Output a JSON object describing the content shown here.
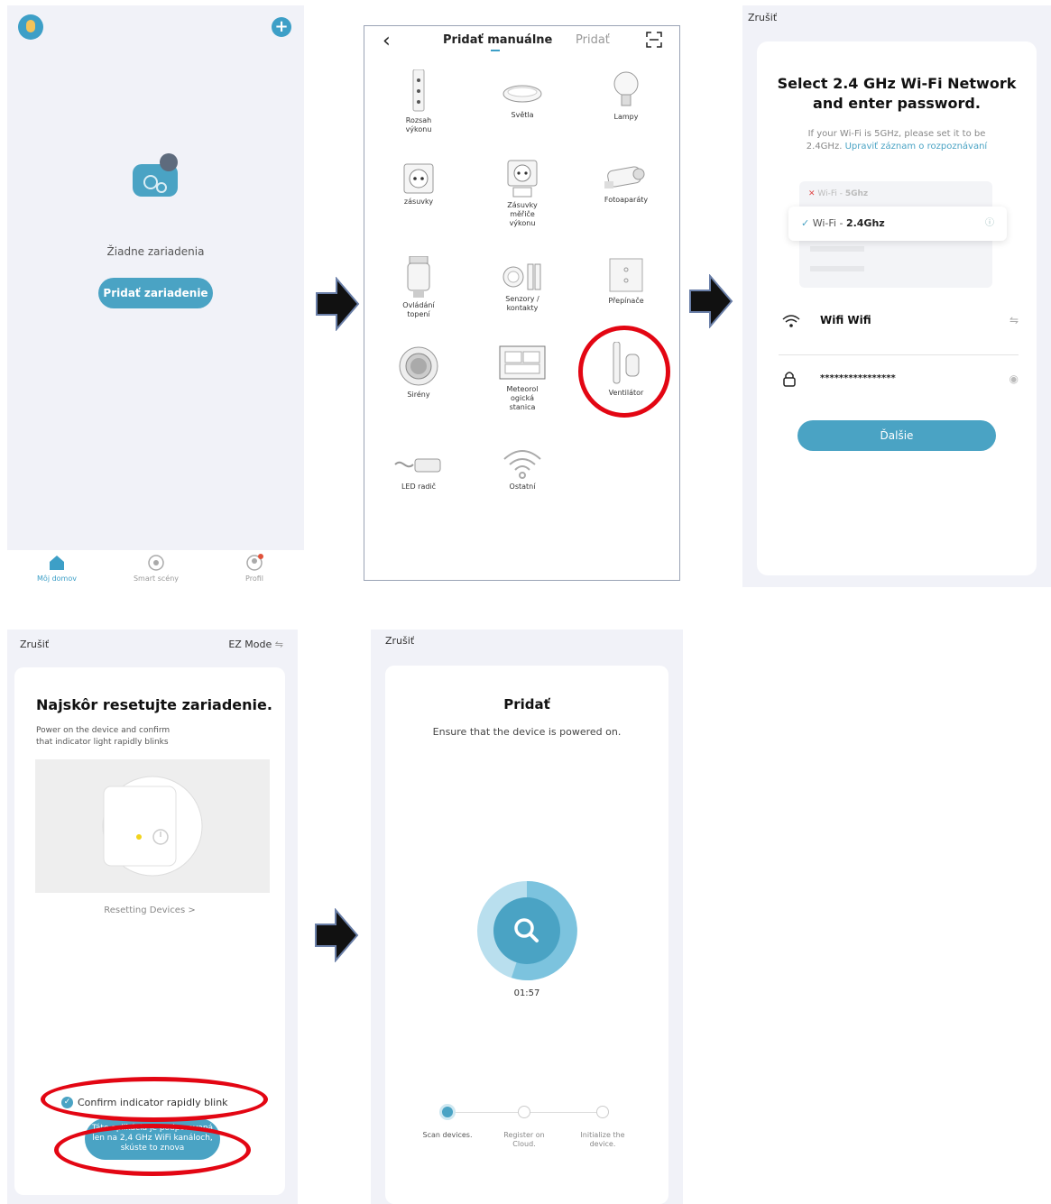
{
  "panel_home": {
    "empty_text": "Žiadne zariadenia",
    "add_button": "Pridať zariadenie",
    "tabs": [
      {
        "label": "Môj domov",
        "active": true
      },
      {
        "label": "Smart scény",
        "active": false
      },
      {
        "label": "Profil",
        "active": false
      }
    ]
  },
  "panel_manual": {
    "tab_active": "Pridať manuálne",
    "tab_other": "Pridať",
    "categories": [
      {
        "label": "Rozsah\nvýkonu"
      },
      {
        "label": "Světla"
      },
      {
        "label": "Lampy"
      },
      {
        "label": "zásuvky"
      },
      {
        "label": "Zásuvky\nměřiče\nvýkonu"
      },
      {
        "label": "Fotoaparáty"
      },
      {
        "label": "Ovládání\ntopení"
      },
      {
        "label": "Senzory /\nkontakty"
      },
      {
        "label": "Přepínače"
      },
      {
        "label": "Sirény"
      },
      {
        "label": "Meteorol\nogická\nstanica"
      },
      {
        "label": "Ventilátor"
      },
      {
        "label": "LED radič"
      },
      {
        "label": "Ostatní"
      }
    ]
  },
  "panel_wifi": {
    "cancel": "Zrušiť",
    "title_line1": "Select 2.4 GHz Wi-Fi Network",
    "title_line2": "and enter password.",
    "hint_line1": "If your Wi-Fi is 5GHz, please set it to be",
    "hint_prefix": "2.4GHz.",
    "hint_link": "Upraviť záznam o rozpoznávaní",
    "net_5g_prefix": "Wi-Fi - ",
    "net_5g_band": "5Ghz",
    "net_24_prefix": "Wi-Fi - ",
    "net_24_band": "2.4Ghz",
    "ssid": "Wifi Wifi",
    "password": "****************",
    "next_button": "Ďalšie"
  },
  "panel_reset": {
    "cancel": "Zrušiť",
    "mode": "EZ Mode",
    "title": "Najskôr resetujte zariadenie.",
    "desc_line1": "Power on the device and confirm",
    "desc_line2": "that indicator light rapidly blinks",
    "reset_link": "Resetting Devices >",
    "confirm": "Confirm indicator rapidly blink",
    "warn_line1": "Táto aplikácia je podporovaná",
    "warn_line2": "len na 2,4 GHz WiFi kanáloch,",
    "warn_line3": "skúste to znova"
  },
  "panel_adding": {
    "cancel": "Zrušiť",
    "title": "Pridať",
    "subtitle": "Ensure that the device is powered on.",
    "timer": "01:57",
    "steps": [
      {
        "label": "Scan devices.",
        "done": true
      },
      {
        "label": "Register on\nCloud.",
        "done": false
      },
      {
        "label": "Initialize the\ndevice.",
        "done": false
      }
    ]
  },
  "colors": {
    "accent": "#4aa3c4",
    "highlight_ring": "#e30613",
    "panel_bg": "#f1f2f8"
  }
}
